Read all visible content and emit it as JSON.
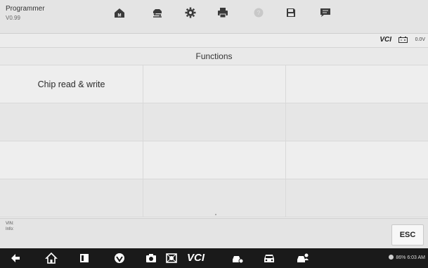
{
  "app": {
    "title": "Programmer",
    "version": "V0.99"
  },
  "toolbar": {
    "buttons": [
      {
        "name": "home",
        "icon": "home-icon"
      },
      {
        "name": "vehicle-swap",
        "icon": "vehicle-swap-icon"
      },
      {
        "name": "settings",
        "icon": "gear-icon"
      },
      {
        "name": "print",
        "icon": "printer-icon"
      },
      {
        "name": "help",
        "icon": "help-icon"
      },
      {
        "name": "save",
        "icon": "save-icon"
      },
      {
        "name": "message",
        "icon": "chat-icon"
      }
    ]
  },
  "status": {
    "vci_label": "VCI",
    "voltage": "0.0V"
  },
  "functions": {
    "header": "Functions",
    "items": [
      "Chip read & write",
      "",
      "",
      "",
      "",
      "",
      "",
      "",
      "",
      "",
      "",
      ""
    ]
  },
  "footer": {
    "vin_label": "VIN:",
    "info_label": "Info:",
    "esc_label": "ESC"
  },
  "navbar": {
    "vcs_label": "VCI",
    "status_text": "86% 6:03 AM"
  },
  "colors": {
    "background": "#ececec",
    "navbar": "#1a1a1a",
    "toolbar_icon": "#3a3a3a",
    "help_icon": "#c8c8c8"
  }
}
